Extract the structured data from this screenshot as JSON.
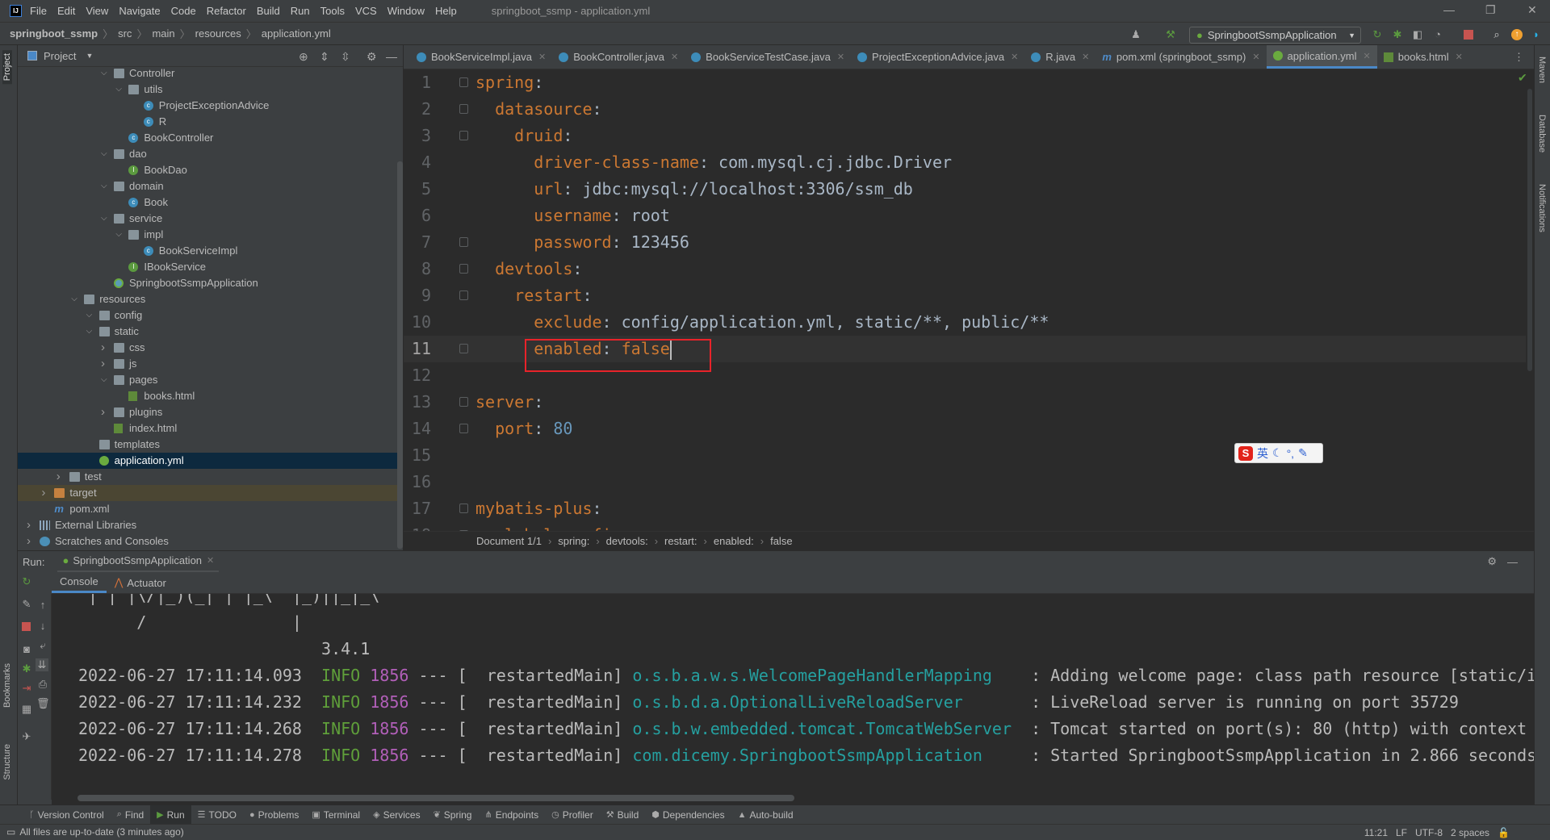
{
  "menubar": {
    "items": [
      "File",
      "Edit",
      "View",
      "Navigate",
      "Code",
      "Refactor",
      "Build",
      "Run",
      "Tools",
      "VCS",
      "Window",
      "Help"
    ],
    "title": "springboot_ssmp - application.yml"
  },
  "navbar": {
    "crumbs": [
      "springboot_ssmp",
      "src",
      "main",
      "resources",
      "application.yml"
    ],
    "run_config": "SpringbootSsmpApplication"
  },
  "left_strip": {
    "project": "Project",
    "bookmarks": "Bookmarks",
    "structure": "Structure"
  },
  "right_strip": {
    "maven": "Maven",
    "database": "Database",
    "notifications": "Notifications"
  },
  "project_panel": {
    "title": "Project",
    "tree": [
      {
        "label": "Controller",
        "depth": 5,
        "icon": "folder",
        "state": "open"
      },
      {
        "label": "utils",
        "depth": 6,
        "icon": "folder",
        "state": "open"
      },
      {
        "label": "ProjectExceptionAdvice",
        "depth": 7,
        "icon": "class"
      },
      {
        "label": "R",
        "depth": 7,
        "icon": "class"
      },
      {
        "label": "BookController",
        "depth": 6,
        "icon": "class"
      },
      {
        "label": "dao",
        "depth": 5,
        "icon": "folder",
        "state": "open"
      },
      {
        "label": "BookDao",
        "depth": 6,
        "icon": "interface"
      },
      {
        "label": "domain",
        "depth": 5,
        "icon": "folder",
        "state": "open"
      },
      {
        "label": "Book",
        "depth": 6,
        "icon": "class"
      },
      {
        "label": "service",
        "depth": 5,
        "icon": "folder",
        "state": "open"
      },
      {
        "label": "impl",
        "depth": 6,
        "icon": "folder",
        "state": "open"
      },
      {
        "label": "BookServiceImpl",
        "depth": 7,
        "icon": "class"
      },
      {
        "label": "IBookService",
        "depth": 6,
        "icon": "interface"
      },
      {
        "label": "SpringbootSsmpApplication",
        "depth": 5,
        "icon": "spring"
      },
      {
        "label": "resources",
        "depth": 3,
        "icon": "folder",
        "state": "open"
      },
      {
        "label": "config",
        "depth": 4,
        "icon": "folder",
        "state": "open"
      },
      {
        "label": "static",
        "depth": 4,
        "icon": "folder",
        "state": "open"
      },
      {
        "label": "css",
        "depth": 5,
        "icon": "folder",
        "state": "closed"
      },
      {
        "label": "js",
        "depth": 5,
        "icon": "folder",
        "state": "closed"
      },
      {
        "label": "pages",
        "depth": 5,
        "icon": "folder",
        "state": "open"
      },
      {
        "label": "books.html",
        "depth": 6,
        "icon": "html"
      },
      {
        "label": "plugins",
        "depth": 5,
        "icon": "folder",
        "state": "closed"
      },
      {
        "label": "index.html",
        "depth": 5,
        "icon": "html"
      },
      {
        "label": "templates",
        "depth": 4,
        "icon": "folder"
      },
      {
        "label": "application.yml",
        "depth": 4,
        "icon": "yml",
        "selected": true
      },
      {
        "label": "test",
        "depth": 2,
        "icon": "folder",
        "state": "closed"
      },
      {
        "label": "target",
        "depth": 1,
        "icon": "folder-orange",
        "state": "closed",
        "excluded": true
      },
      {
        "label": "pom.xml",
        "depth": 1,
        "icon": "maven"
      },
      {
        "label": "External Libraries",
        "depth": 0,
        "icon": "lib",
        "state": "closed"
      },
      {
        "label": "Scratches and Consoles",
        "depth": 0,
        "icon": "scratch",
        "state": "closed"
      }
    ]
  },
  "editor": {
    "tabs": [
      {
        "label": "BookServiceImpl.java",
        "icon": "class"
      },
      {
        "label": "BookController.java",
        "icon": "class"
      },
      {
        "label": "BookServiceTestCase.java",
        "icon": "class"
      },
      {
        "label": "ProjectExceptionAdvice.java",
        "icon": "class"
      },
      {
        "label": "R.java",
        "icon": "class"
      },
      {
        "label": "pom.xml (springboot_ssmp)",
        "icon": "maven"
      },
      {
        "label": "application.yml",
        "icon": "yml",
        "active": true
      },
      {
        "label": "books.html",
        "icon": "html"
      }
    ],
    "current_line": 11,
    "lines": [
      {
        "n": "1",
        "fold": true,
        "tokens": [
          [
            "k",
            "spring"
          ],
          [
            "p",
            ":"
          ]
        ]
      },
      {
        "n": "2",
        "fold": true,
        "tokens": [
          [
            "p",
            "  "
          ],
          [
            "k",
            "datasource"
          ],
          [
            "p",
            ":"
          ]
        ]
      },
      {
        "n": "3",
        "fold": true,
        "tokens": [
          [
            "p",
            "    "
          ],
          [
            "k",
            "druid"
          ],
          [
            "p",
            ":"
          ]
        ]
      },
      {
        "n": "4",
        "tokens": [
          [
            "p",
            "      "
          ],
          [
            "k",
            "driver-class-name"
          ],
          [
            "p",
            ": com.mysql.cj.jdbc.Driver"
          ]
        ]
      },
      {
        "n": "5",
        "tokens": [
          [
            "p",
            "      "
          ],
          [
            "k",
            "url"
          ],
          [
            "p",
            ": jdbc:mysql://localhost:3306/ssm_db"
          ]
        ]
      },
      {
        "n": "6",
        "tokens": [
          [
            "p",
            "      "
          ],
          [
            "k",
            "username"
          ],
          [
            "p",
            ": root"
          ]
        ]
      },
      {
        "n": "7",
        "fold": true,
        "tokens": [
          [
            "p",
            "      "
          ],
          [
            "k",
            "password"
          ],
          [
            "p",
            ": 123456"
          ]
        ]
      },
      {
        "n": "8",
        "fold": true,
        "tokens": [
          [
            "p",
            "  "
          ],
          [
            "k",
            "devtools"
          ],
          [
            "p",
            ":"
          ]
        ]
      },
      {
        "n": "9",
        "fold": true,
        "tokens": [
          [
            "p",
            "    "
          ],
          [
            "k",
            "restart"
          ],
          [
            "p",
            ":"
          ]
        ]
      },
      {
        "n": "10",
        "tokens": [
          [
            "p",
            "      "
          ],
          [
            "k",
            "exclude"
          ],
          [
            "p",
            ": config/application.yml, static/**, public/**"
          ]
        ]
      },
      {
        "n": "11",
        "fold": true,
        "tokens": [
          [
            "p",
            "      "
          ],
          [
            "k",
            "enabled"
          ],
          [
            "p",
            ": "
          ],
          [
            "k",
            "false"
          ]
        ]
      },
      {
        "n": "12",
        "tokens": []
      },
      {
        "n": "13",
        "fold": true,
        "tokens": [
          [
            "k",
            "server"
          ],
          [
            "p",
            ":"
          ]
        ]
      },
      {
        "n": "14",
        "fold": true,
        "tokens": [
          [
            "p",
            "  "
          ],
          [
            "k",
            "port"
          ],
          [
            "p",
            ": "
          ],
          [
            "n",
            "80"
          ]
        ]
      },
      {
        "n": "15",
        "tokens": []
      },
      {
        "n": "16",
        "tokens": []
      },
      {
        "n": "17",
        "fold": true,
        "tokens": [
          [
            "k",
            "mybatis-plus"
          ],
          [
            "p",
            ":"
          ]
        ]
      },
      {
        "n": "18",
        "fold": true,
        "tokens": [
          [
            "p",
            "  "
          ],
          [
            "k",
            "global-config"
          ],
          [
            "p",
            ":"
          ]
        ]
      }
    ],
    "breadcrumb": [
      "Document 1/1",
      "spring:",
      "devtools:",
      "restart:",
      "enabled:",
      "false"
    ],
    "highlight_color": "#e8232a",
    "ime": {
      "label": "英"
    }
  },
  "run_panel": {
    "label": "Run:",
    "tab": "SpringbootSsmpApplication",
    "console_tabs": [
      "Console",
      "Actuator"
    ],
    "banner": [
      " | | |\\/|_)(_| | |_\\  |_)||_|_\\",
      "      /               |",
      "                         3.4.1"
    ],
    "logs": [
      {
        "ts": "2022-06-27 17:11:14.093",
        "level": "INFO",
        "pid": "1856",
        "thread": " --- [  restartedMain] ",
        "logger": "o.s.b.a.w.s.WelcomePageHandlerMapping",
        "msg": ": Adding welcome page: class path resource [static/in"
      },
      {
        "ts": "2022-06-27 17:11:14.232",
        "level": "INFO",
        "pid": "1856",
        "thread": " --- [  restartedMain] ",
        "logger": "o.s.b.d.a.OptionalLiveReloadServer",
        "msg": ": LiveReload server is running on port 35729"
      },
      {
        "ts": "2022-06-27 17:11:14.268",
        "level": "INFO",
        "pid": "1856",
        "thread": " --- [  restartedMain] ",
        "logger": "o.s.b.w.embedded.tomcat.TomcatWebServer",
        "msg": ": Tomcat started on port(s): 80 (http) with context p"
      },
      {
        "ts": "2022-06-27 17:11:14.278",
        "level": "INFO",
        "pid": "1856",
        "thread": " --- [  restartedMain] ",
        "logger": "com.dicemy.SpringbootSsmpApplication",
        "msg": ": Started SpringbootSsmpApplication in 2.866 seconds"
      }
    ]
  },
  "tool_windows": [
    {
      "label": "Version Control",
      "icon": "ᚴ"
    },
    {
      "label": "Find",
      "icon": "⌕"
    },
    {
      "label": "Run",
      "icon": "▶",
      "active": true
    },
    {
      "label": "TODO",
      "icon": "☰"
    },
    {
      "label": "Problems",
      "icon": "●"
    },
    {
      "label": "Terminal",
      "icon": "▣"
    },
    {
      "label": "Services",
      "icon": "◈"
    },
    {
      "label": "Spring",
      "icon": "❦"
    },
    {
      "label": "Endpoints",
      "icon": "⋔"
    },
    {
      "label": "Profiler",
      "icon": "◷"
    },
    {
      "label": "Build",
      "icon": "⚒"
    },
    {
      "label": "Dependencies",
      "icon": "⬢"
    },
    {
      "label": "Auto-build",
      "icon": "▲"
    }
  ],
  "statusbar": {
    "message": "All files are up-to-date (3 minutes ago)",
    "position": "11:21",
    "line_sep": "LF",
    "encoding": "UTF-8",
    "indent": "2 spaces"
  }
}
